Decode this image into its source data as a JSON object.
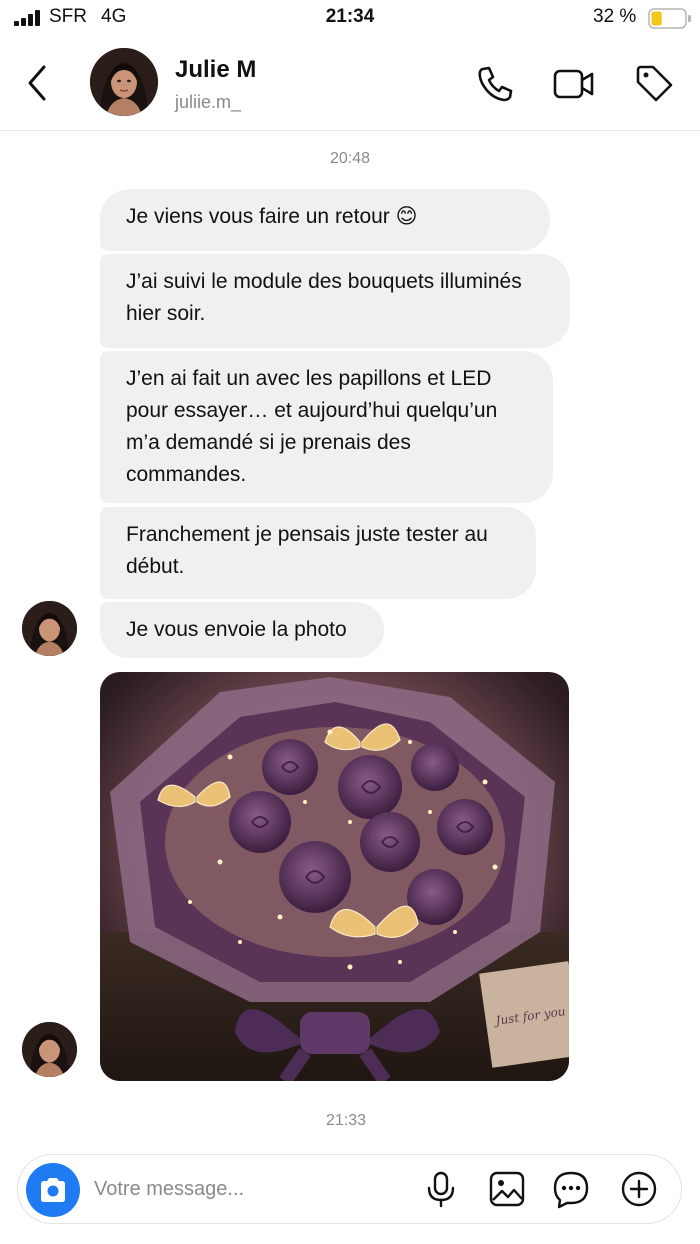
{
  "status_bar": {
    "carrier": "SFR",
    "network": "4G",
    "time": "21:34",
    "battery_percent": "32 %",
    "battery_level": 0.32,
    "icons": [
      "signal-icon",
      "battery-icon"
    ]
  },
  "header": {
    "contact_name": "Julie M",
    "contact_username": "juliie.m_",
    "icons": [
      "back-icon",
      "phone-icon",
      "video-icon",
      "tag-icon"
    ]
  },
  "conversation": {
    "timestamp_top": "20:48",
    "messages": [
      {
        "text": "Je viens vous faire un retour 😊"
      },
      {
        "text": "J’ai suivi le module des bouquets illuminés hier soir."
      },
      {
        "text": "J’en ai fait un avec les papillons et LED pour essayer… et aujourd’hui quelqu’un m’a demandé si je prenais des commandes."
      },
      {
        "text": "Franchement je pensais juste tester au début."
      },
      {
        "text": "Je vous envoie la photo"
      }
    ],
    "photo": {
      "tag_text": "Just for you"
    },
    "timestamp_bottom": "21:33"
  },
  "composer": {
    "placeholder": "Votre message...",
    "icons": [
      "camera-icon",
      "microphone-icon",
      "gallery-icon",
      "sticker-icon",
      "add-icon"
    ]
  },
  "colors": {
    "accent": "#1e7bf2",
    "bubble": "#f0f0f0",
    "muted_text": "#8a8a8a",
    "battery_fill": "#f5c518"
  }
}
